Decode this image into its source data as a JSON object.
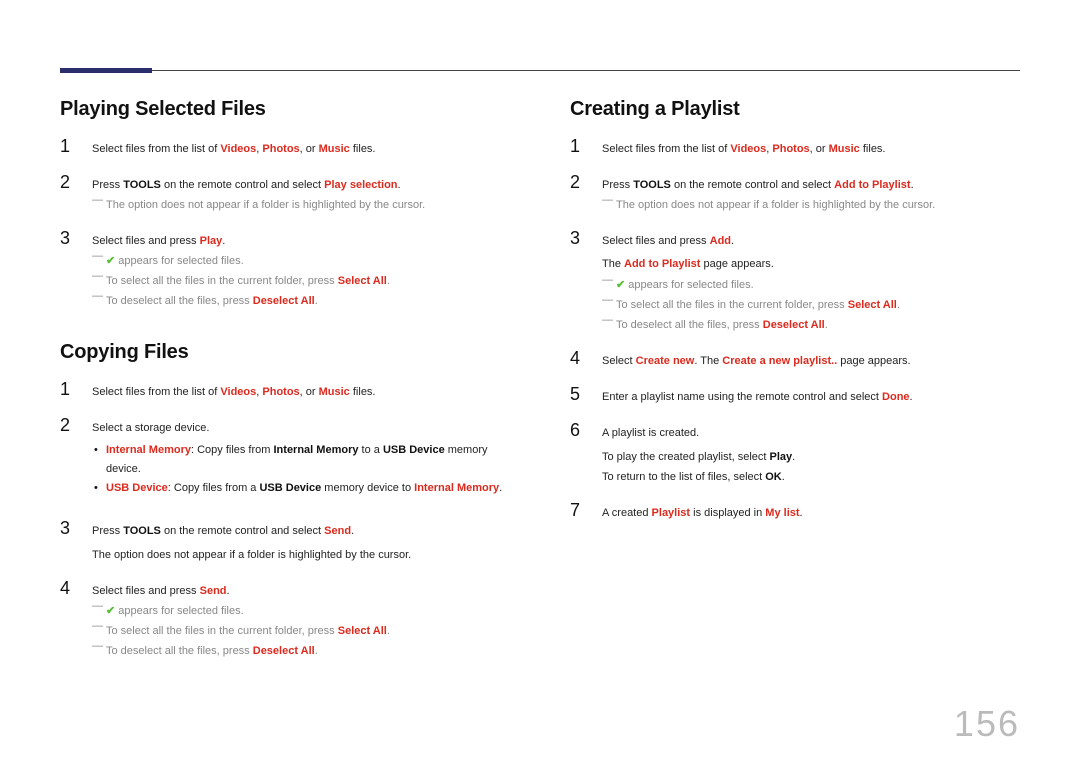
{
  "page_number": "156",
  "left": {
    "section1": {
      "title": "Playing Selected Files",
      "steps": [
        {
          "num": "1",
          "pre": "Select files from the list of ",
          "r1": "Videos",
          "c1": ", ",
          "r2": "Photos",
          "c2": ", or ",
          "r3": "Music",
          "post": " files."
        },
        {
          "num": "2",
          "pre": "Press ",
          "b1": "TOOLS",
          "mid": " on the remote control and select ",
          "r1": "Play selection",
          "post": ".",
          "note1_a": "The option does not appear if a folder is highlighted by the cursor."
        },
        {
          "num": "3",
          "pre": "Select files and press ",
          "r1": "Play",
          "post": ".",
          "chk_post": " appears for selected files.",
          "note2_a": "To select all the files in the current folder, press ",
          "note2_b": "Select All",
          "note2_c": ".",
          "note3_a": "To deselect all the files, press ",
          "note3_b": "Deselect All",
          "note3_c": "."
        }
      ]
    },
    "section2": {
      "title": "Copying Files",
      "steps": [
        {
          "num": "1",
          "pre": "Select files from the list of ",
          "r1": "Videos",
          "c1": ", ",
          "r2": "Photos",
          "c2": ", or ",
          "r3": "Music",
          "post": " files."
        },
        {
          "num": "2",
          "pre": "Select a storage device.",
          "bul1_a": "Internal Memory",
          "bul1_b": ": Copy files from ",
          "bul1_c": "Internal Memory",
          "bul1_d": " to a ",
          "bul1_e": "USB Device",
          "bul1_f": " memory device.",
          "bul2_a": "USB Device",
          "bul2_b": ": Copy files from a ",
          "bul2_c": "USB Device",
          "bul2_d": " memory device to ",
          "bul2_e": "Internal Memory",
          "bul2_f": "."
        },
        {
          "num": "3",
          "pre": "Press ",
          "b1": "TOOLS",
          "mid": " on the remote control and select ",
          "r1": "Send",
          "post": ".",
          "plain": "The option does not appear if a folder is highlighted by the cursor."
        },
        {
          "num": "4",
          "pre": "Select files and press ",
          "r1": "Send",
          "post": ".",
          "chk_post": " appears for selected files.",
          "note2_a": "To select all the files in the current folder, press ",
          "note2_b": "Select All",
          "note2_c": ".",
          "note3_a": "To deselect all the files, press ",
          "note3_b": "Deselect All",
          "note3_c": "."
        }
      ]
    }
  },
  "right": {
    "section1": {
      "title": "Creating a Playlist",
      "steps": [
        {
          "num": "1",
          "pre": "Select files from the list of ",
          "r1": "Videos",
          "c1": ", ",
          "r2": "Photos",
          "c2": ", or ",
          "r3": "Music",
          "post": " files."
        },
        {
          "num": "2",
          "pre": "Press ",
          "b1": "TOOLS",
          "mid": " on the remote control and select ",
          "r1": "Add to Playlist",
          "post": ".",
          "note1_a": "The option does not appear if a folder is highlighted by the cursor."
        },
        {
          "num": "3",
          "pre": "Select files and press ",
          "r1": "Add",
          "post": ".",
          "plain_a": "The ",
          "plain_b": "Add to Playlist",
          "plain_c": " page appears.",
          "chk_post": " appears for selected files.",
          "note2_a": "To select all the files in the current folder, press ",
          "note2_b": "Select All",
          "note2_c": ".",
          "note3_a": "To deselect all the files, press ",
          "note3_b": "Deselect All",
          "note3_c": "."
        },
        {
          "num": "4",
          "pre": "Select ",
          "r1": "Create new",
          "mid": ". The ",
          "r2": "Create a new playlist..",
          "post": " page appears."
        },
        {
          "num": "5",
          "pre": "Enter a playlist name using the remote control and select ",
          "r1": "Done",
          "post": "."
        },
        {
          "num": "6",
          "pre": "A playlist is created.",
          "plain1_a": "To play the created playlist, select ",
          "plain1_b": "Play",
          "plain1_c": ".",
          "plain2_a": "To return to the list of files, select ",
          "plain2_b": "OK",
          "plain2_c": "."
        },
        {
          "num": "7",
          "pre": "A created ",
          "r1": "Playlist",
          "mid": " is displayed in ",
          "r2": "My list",
          "post": "."
        }
      ]
    }
  }
}
